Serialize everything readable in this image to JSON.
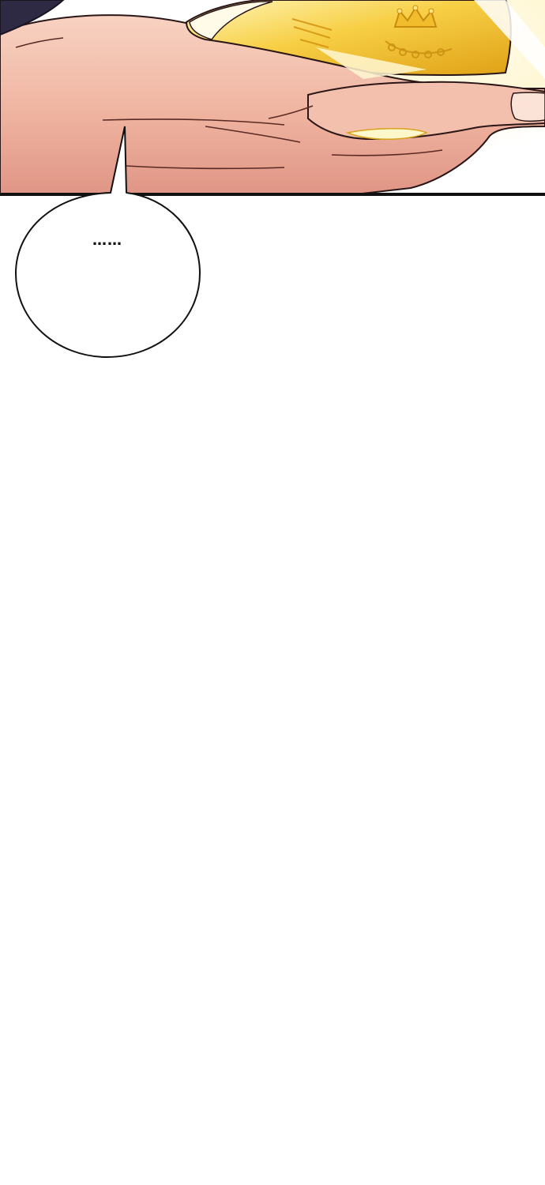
{
  "panel": {
    "colors": {
      "skin_light": "#f6c7b6",
      "skin_mid": "#ecab98",
      "skin_shadow": "#d9877a",
      "gold_light": "#fff3a6",
      "gold_mid": "#f5c83a",
      "gold_dark": "#d99a12",
      "glow": "#fffbe2",
      "dark_clothing": "#2e2a44",
      "outline": "#2a1616",
      "border": "#111111"
    },
    "icons": {
      "crown": "crown-icon",
      "laurel": "laurel-icon"
    }
  },
  "bubble": {
    "text": "……",
    "fill": "#ffffff",
    "stroke": "#111111"
  }
}
